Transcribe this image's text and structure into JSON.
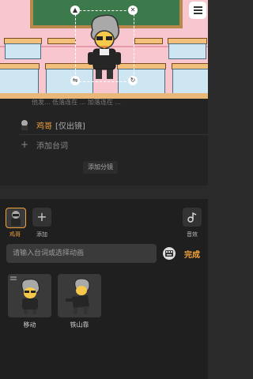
{
  "colors": {
    "accent": "#f2a23a",
    "panel_bg": "#1f1f1f",
    "script_bg": "#232323",
    "scene_wall": "#f7c6cf",
    "chalkboard": "#3c7a4c"
  },
  "scene": {
    "background_text": "他发... 低落连在 ... 加落连在 ... "
  },
  "script": {
    "role_name": "鸡哥",
    "role_note": "[仅出镜]",
    "add_line": "添加台词",
    "add_shot": "添加分镜"
  },
  "toolbar": {
    "active_role_label": "鸡哥",
    "add_label": "添加",
    "effect_label": "音效"
  },
  "input": {
    "placeholder": "请输入台词或选择动画",
    "done_label": "完成"
  },
  "animations": [
    {
      "label": "移动"
    },
    {
      "label": "铁山靠"
    }
  ],
  "icons": {
    "menu": "menu-icon",
    "delete": "close-icon",
    "layer": "layer-icon",
    "flip": "flip-icon",
    "rotate": "rotate-icon",
    "add": "plus-icon",
    "effect": "note-icon",
    "keyboard": "keyboard-icon"
  }
}
